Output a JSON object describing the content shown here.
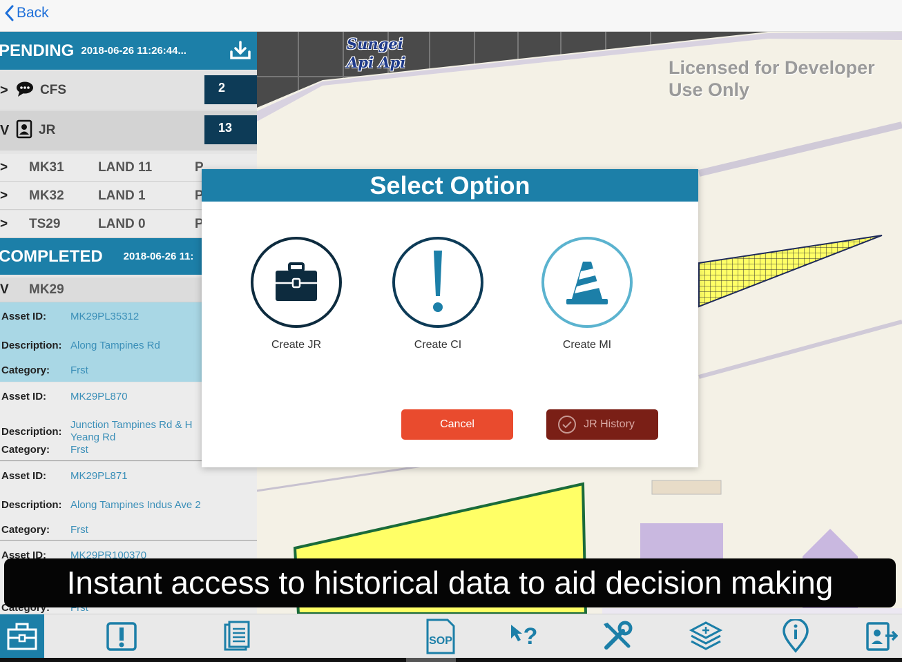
{
  "nav": {
    "back_label": "Back"
  },
  "map": {
    "labels": [
      "Sungei",
      "Api Api"
    ],
    "watermark": "Licensed for Developer Use Only"
  },
  "panel": {
    "pending": {
      "title": "PENDING",
      "timestamp": "2018-06-26 11:26:44..."
    },
    "groups": [
      {
        "label": "CFS",
        "count": "2",
        "icon": "chat-icon",
        "chevron": ">"
      },
      {
        "label": "JR",
        "count": "13",
        "icon": "contact-card-icon",
        "chevron": "V"
      }
    ],
    "items": [
      {
        "chevron": ">",
        "code": "MK31",
        "land": "LAND 11",
        "extra": "P"
      },
      {
        "chevron": ">",
        "code": "MK32",
        "land": "LAND 1",
        "extra": "P"
      },
      {
        "chevron": ">",
        "code": "TS29",
        "land": "LAND 0",
        "extra": "P"
      }
    ],
    "completed": {
      "title": "COMPLETED",
      "timestamp": "2018-06-26 11:"
    },
    "completed_group": {
      "chevron": "V",
      "label": "MK29"
    },
    "field_labels": {
      "asset_id": "Asset ID:",
      "description": "Description:",
      "category": "Category:"
    },
    "assets": [
      {
        "id": "MK29PL35312",
        "description": "Along Tampines Rd",
        "category": "Frst"
      },
      {
        "id": "MK29PL870",
        "description_line1": "Junction Tampines Rd & H",
        "description_line2": "Yeang Rd",
        "category": "Frst"
      },
      {
        "id": "MK29PL871",
        "description": "Along Tampines Indus Ave 2",
        "category": "Frst"
      },
      {
        "id": "MK29PR100370",
        "category_partial": "Category:",
        "category": "Frst"
      }
    ]
  },
  "modal": {
    "title": "Select Option",
    "options": [
      {
        "label": "Create JR",
        "icon": "briefcase-icon"
      },
      {
        "label": "Create CI",
        "icon": "exclamation-icon"
      },
      {
        "label": "Create MI",
        "icon": "traffic-cone-icon"
      }
    ],
    "cancel_label": "Cancel",
    "history_label": "JR History"
  },
  "caption": "Instant access to historical data to aid decision making",
  "toolbar": {
    "items": [
      "briefcase-icon",
      "exclamation-icon",
      "document-list-icon",
      "sop-icon",
      "pointer-question-icon",
      "tools-icon",
      "layers-icon",
      "location-info-icon",
      "logout-icon"
    ],
    "sop_text": "SOP"
  },
  "colors": {
    "primary": "#1c7fa8",
    "dark": "#0d3b57",
    "cancel": "#e94b2e",
    "history": "#7a1f16",
    "map_bg": "#f4f1e6",
    "map_yellow": "#ffff66"
  }
}
